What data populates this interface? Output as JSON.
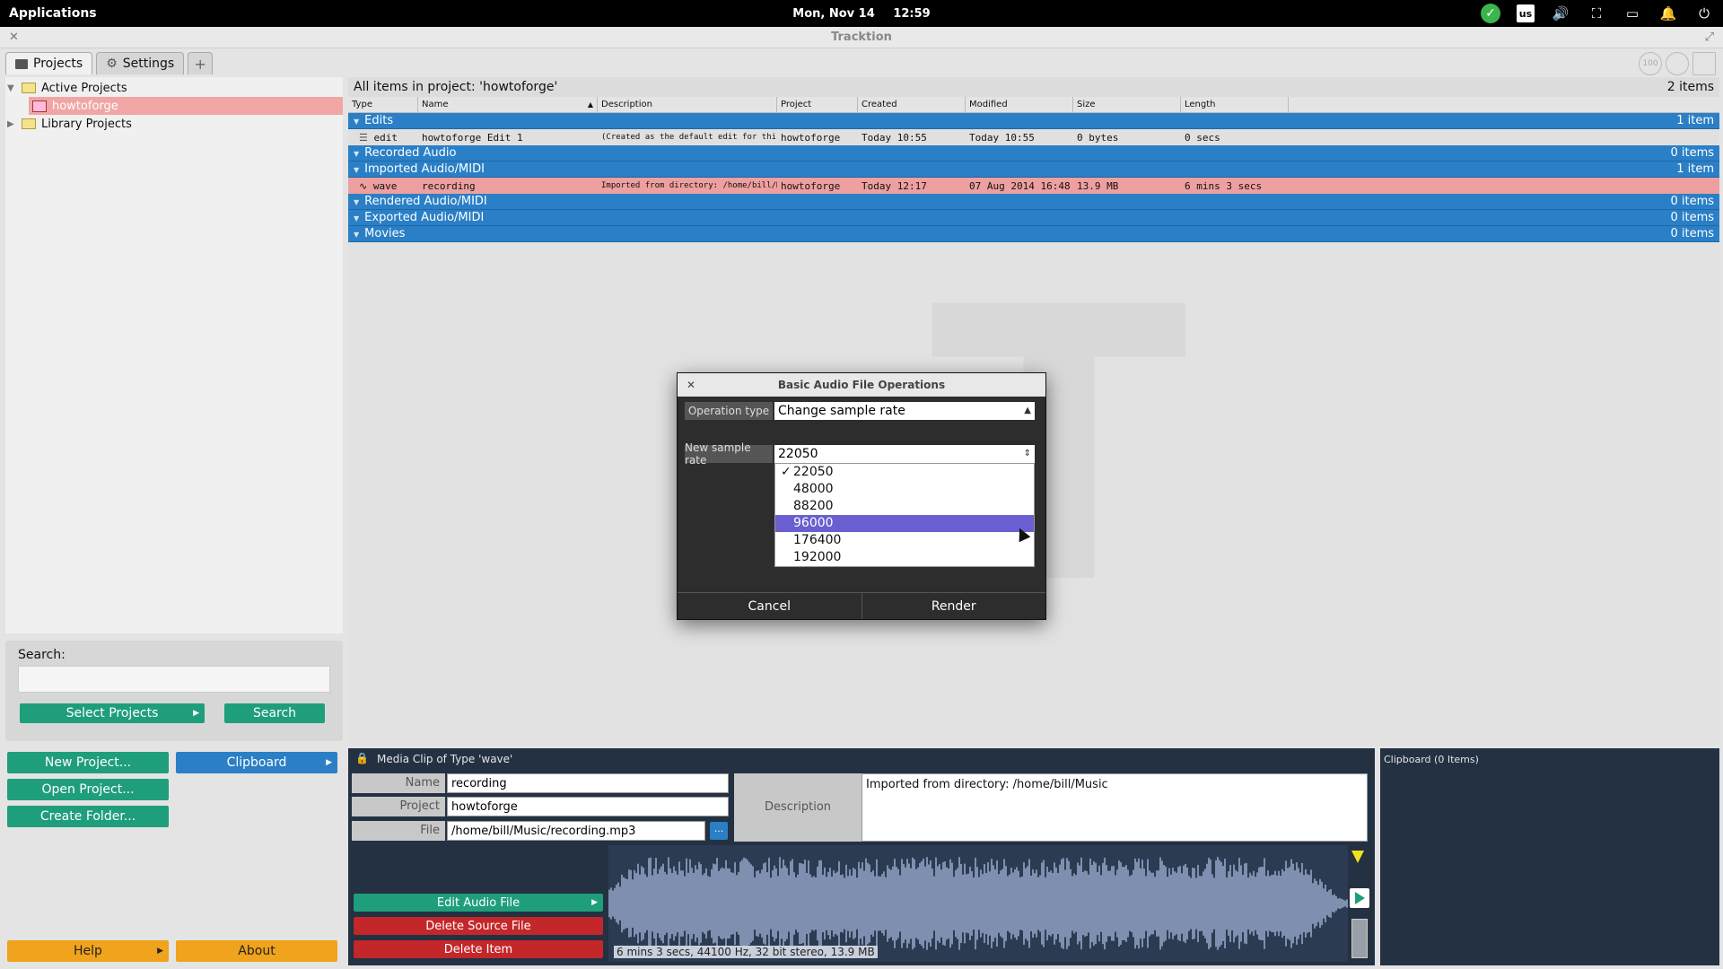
{
  "system_bar": {
    "apps_label": "Applications",
    "date": "Mon, Nov 14",
    "time": "12:59",
    "keyboard_layout": "us"
  },
  "window": {
    "title": "Tracktion"
  },
  "tabs": [
    {
      "label": "Projects",
      "icon": "folder-icon",
      "active": true
    },
    {
      "label": "Settings",
      "icon": "gear-icon",
      "active": false
    },
    {
      "label": "+",
      "icon": "add-tab-icon",
      "active": false
    }
  ],
  "top_controls": [
    "100",
    "",
    ""
  ],
  "tree": {
    "items": [
      {
        "label": "Active Projects",
        "expanded": true
      },
      {
        "label": "howtoforge",
        "selected": true
      },
      {
        "label": "Library Projects",
        "expanded": false
      }
    ]
  },
  "search": {
    "label": "Search:",
    "value": "",
    "select_projects_label": "Select Projects",
    "search_button_label": "Search"
  },
  "left_buttons": {
    "new_project": "New Project...",
    "clipboard": "Clipboard",
    "open_project": "Open Project...",
    "create_folder": "Create Folder...",
    "help": "Help",
    "about": "About"
  },
  "list": {
    "header_title": "All items in project: 'howtoforge'",
    "header_count": "2 items",
    "columns": [
      "Type",
      "Name",
      "Description",
      "Project",
      "Created",
      "Modified",
      "Size",
      "Length"
    ],
    "groups": [
      {
        "label": "Edits",
        "count": "1 item",
        "rows": [
          {
            "kind": "edit",
            "type": "edit",
            "name": "howtoforge Edit 1",
            "description": "(Created as the default edit for this...",
            "project": "howtoforge",
            "created": "Today 10:55",
            "modified": "Today 10:55",
            "size": "0 bytes",
            "length": "0 secs"
          }
        ]
      },
      {
        "label": "Recorded Audio",
        "count": "0 items",
        "rows": []
      },
      {
        "label": "Imported Audio/MIDI",
        "count": "1 item",
        "rows": [
          {
            "kind": "wave",
            "type": "wave",
            "name": "recording",
            "description": "Imported from directory: /home/bill/Music",
            "project": "howtoforge",
            "created": "Today 12:17",
            "modified": "07 Aug 2014 16:48",
            "size": "13.9 MB",
            "length": "6 mins 3 secs"
          }
        ]
      },
      {
        "label": "Rendered Audio/MIDI",
        "count": "0 items",
        "rows": []
      },
      {
        "label": "Exported Audio/MIDI",
        "count": "0 items",
        "rows": []
      },
      {
        "label": "Movies",
        "count": "0 items",
        "rows": []
      }
    ]
  },
  "dialog": {
    "title": "Basic Audio File Operations",
    "operation_type_label": "Operation type",
    "operation_type_value": "Change sample rate",
    "sample_rate_label": "New sample rate",
    "sample_rate_value": "22050",
    "sample_rate_options": [
      "22050",
      "48000",
      "88200",
      "96000",
      "176400",
      "192000"
    ],
    "checked_option": "22050",
    "highlighted_option": "96000",
    "cancel_label": "Cancel",
    "render_label": "Render"
  },
  "clip_panel": {
    "title": "Media Clip of Type 'wave'",
    "name_label": "Name",
    "name_value": "recording",
    "project_label": "Project",
    "project_value": "howtoforge",
    "file_label": "File",
    "file_value": "/home/bill/Music/recording.mp3",
    "browse_label": "...",
    "description_label": "Description",
    "description_value": "Imported from directory: /home/bill/Music",
    "edit_audio_label": "Edit Audio File",
    "delete_source_label": "Delete Source File",
    "delete_item_label": "Delete Item",
    "wave_info": "6 mins 3 secs, 44100 Hz, 32 bit stereo, 13.9 MB"
  },
  "clipboard_panel": {
    "title": "Clipboard (0 Items)"
  },
  "colors": {
    "group_blue": "#2a7fc6",
    "selected_row": "#ee9f9f",
    "green_button": "#1f9e7c",
    "orange_button": "#f0a31c",
    "red_button": "#c4272a",
    "dropdown_highlight": "#6a5fd0"
  }
}
